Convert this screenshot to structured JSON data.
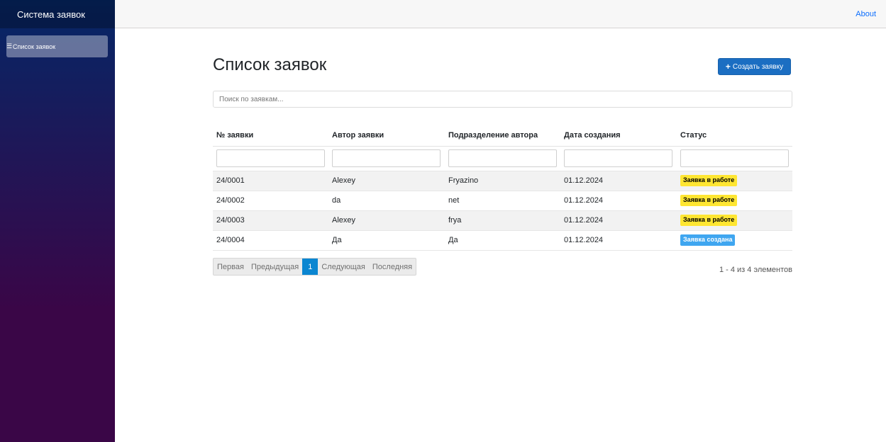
{
  "sidebar": {
    "brand": "Система заявок",
    "items": [
      {
        "icon": "list-icon",
        "label": "Список заявок"
      }
    ]
  },
  "top": {
    "about": "About"
  },
  "main": {
    "title": "Список заявок",
    "create_button": "Создать заявку",
    "search_placeholder": "Поиск по заявкам..."
  },
  "table": {
    "columns": [
      "№ заявки",
      "Автор заявки",
      "Подразделение автора",
      "Дата создания",
      "Статус"
    ],
    "rows": [
      {
        "id": "24/0001",
        "author": "Alexey",
        "department": "Fryazino",
        "date": "01.12.2024",
        "status": "Заявка в работе",
        "status_color": "#ffe632"
      },
      {
        "id": "24/0002",
        "author": "da",
        "department": "net",
        "date": "01.12.2024",
        "status": "Заявка в работе",
        "status_color": "#ffe632"
      },
      {
        "id": "24/0003",
        "author": "Alexey",
        "department": "frya",
        "date": "01.12.2024",
        "status": "Заявка в работе",
        "status_color": "#ffe632"
      },
      {
        "id": "24/0004",
        "author": "Да",
        "department": "Да",
        "date": "01.12.2024",
        "status": "Заявка создана",
        "status_color": "#3fa6f0"
      }
    ]
  },
  "pager": {
    "first": "Первая",
    "prev": "Предыдущая",
    "current": "1",
    "next": "Следующая",
    "last": "Последняя",
    "info": "1 - 4 из 4 элементов"
  },
  "colors": {
    "accent": "#1b6ec2",
    "pager_active": "#0b86d1",
    "sidebar_top": "#052767",
    "sidebar_bottom": "#3a0647"
  }
}
